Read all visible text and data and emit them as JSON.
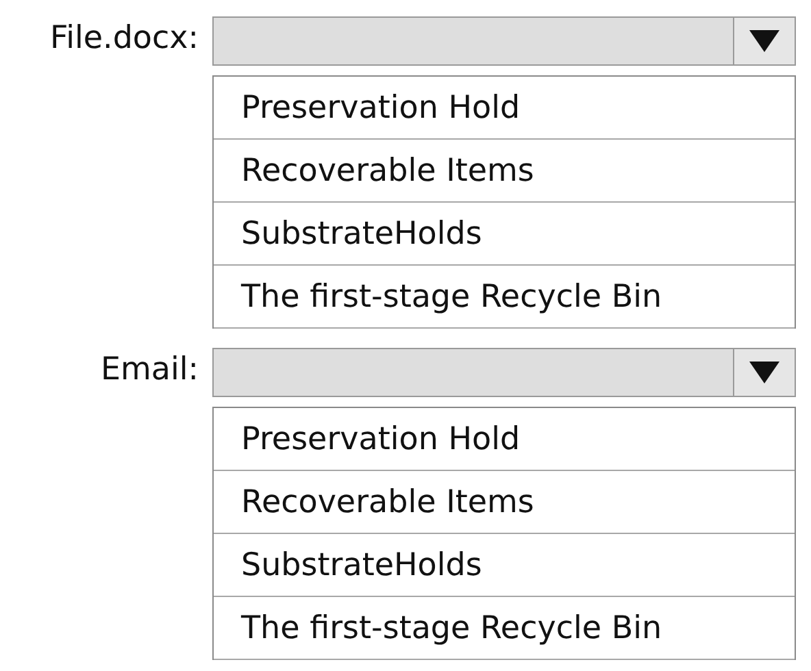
{
  "groups": [
    {
      "label": "File.docx:",
      "options": [
        "Preservation Hold",
        "Recoverable Items",
        "SubstrateHolds",
        "The first-stage Recycle Bin"
      ]
    },
    {
      "label": "Email:",
      "options": [
        "Preservation Hold",
        "Recoverable Items",
        "SubstrateHolds",
        "The first-stage Recycle Bin"
      ]
    }
  ]
}
